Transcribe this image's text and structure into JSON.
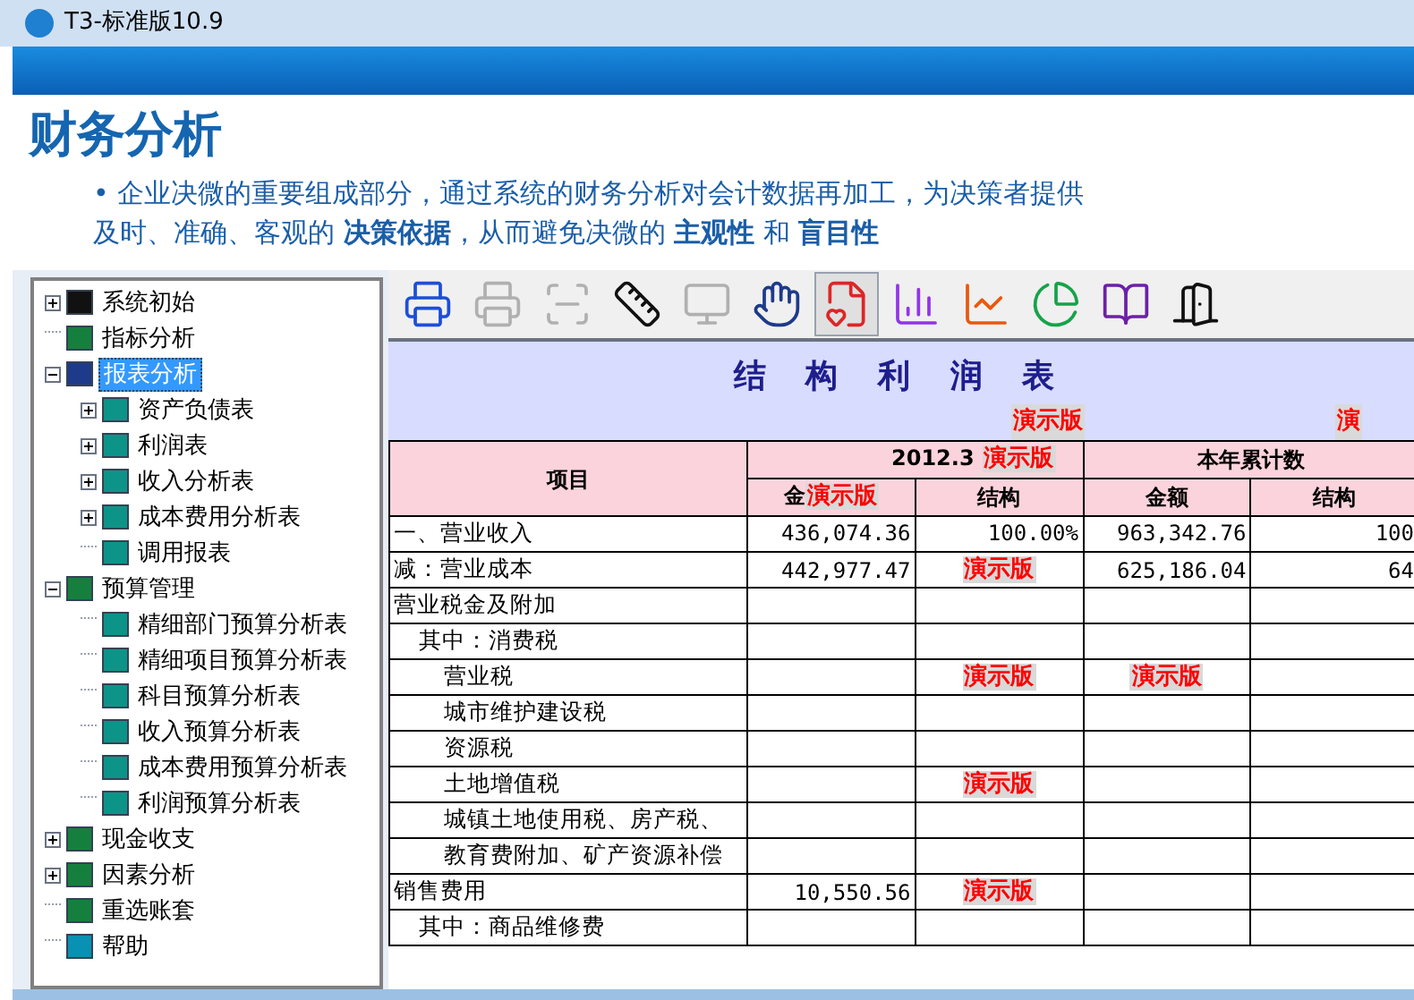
{
  "window": {
    "title": "T3-标准版10.9"
  },
  "heading": "财务分析",
  "description_lines": [
    "• 企业决微的重要组成部分，通过系统的财务分析对会计数据再加工，为决策者提供",
    "及时、准确、客观的 **决策依据**，从而避免决微的 **主观性** 和 **盲目性**"
  ],
  "tree": [
    {
      "label": "系统初始",
      "selected": false,
      "expanded": false
    },
    {
      "label": "指标分析",
      "selected": false
    },
    {
      "label": "报表分析",
      "selected": true,
      "expanded": true,
      "children": [
        {
          "label": "资产负债表",
          "selected": false,
          "expanded": false
        },
        {
          "label": "利润表",
          "selected": false,
          "expanded": false
        },
        {
          "label": "收入分析表",
          "selected": false,
          "expanded": false
        },
        {
          "label": "成本费用分析表",
          "selected": false,
          "expanded": false
        },
        {
          "label": "调用报表",
          "selected": false
        }
      ]
    },
    {
      "label": "预算管理",
      "selected": false,
      "expanded": true,
      "children": [
        {
          "label": "精细部门预算分析表",
          "selected": false
        },
        {
          "label": "精细项目预算分析表",
          "selected": false
        },
        {
          "label": "科目预算分析表",
          "selected": false
        },
        {
          "label": "收入预算分析表",
          "selected": false
        },
        {
          "label": "成本费用预算分析表",
          "selected": false
        },
        {
          "label": "利润预算分析表",
          "selected": false
        }
      ]
    },
    {
      "label": "现金收支",
      "selected": false,
      "expanded": false
    },
    {
      "label": "因素分析",
      "selected": false,
      "expanded": false
    },
    {
      "label": "重选账套",
      "selected": false
    },
    {
      "label": "帮助",
      "selected": false
    }
  ],
  "toolbar": [
    {
      "disabled": false,
      "selected": false
    },
    {
      "disabled": true,
      "selected": false
    },
    {
      "disabled": true,
      "selected": false
    },
    {
      "disabled": false,
      "selected": false
    },
    {
      "disabled": true,
      "selected": false
    },
    {
      "disabled": false,
      "selected": false
    },
    {
      "disabled": false,
      "selected": true
    },
    {
      "disabled": false,
      "selected": false
    },
    {
      "disabled": false,
      "selected": false
    },
    {
      "disabled": false,
      "selected": false
    },
    {
      "disabled": false,
      "selected": false
    },
    {
      "disabled": false,
      "selected": false
    }
  ],
  "report": {
    "title": "结 构 利 润 表",
    "title_stamps": [
      "演示版",
      "演"
    ],
    "header": {
      "item": "项目",
      "period": "2012.3",
      "period_stamp": "演示版",
      "ytd": "本年累计数",
      "columns": [
        {
          "text": "金",
          "stamp": "演示版"
        },
        {
          "text": "结构"
        },
        {
          "text": "金额"
        },
        {
          "text": "结构"
        }
      ]
    },
    "rows": [
      {
        "label": "一、营业收入",
        "cells": [
          {
            "text": "436,074.36"
          },
          {
            "text": "100.00%"
          },
          {
            "text": "963,342.76"
          },
          {
            "text": "100"
          }
        ]
      },
      {
        "label": "减：营业成本",
        "cells": [
          {
            "text": "442,977.47"
          },
          {
            "stamp": "演示版"
          },
          {
            "text": "625,186.04"
          },
          {
            "text": "64"
          }
        ]
      },
      {
        "label": "营业税金及附加",
        "cells": [
          {},
          {},
          {},
          {}
        ],
        "children": [
          {
            "label": "其中：消费税",
            "cells": [
              {},
              {},
              {},
              {}
            ],
            "children": [
              {
                "label": "营业税",
                "cells": [
                  {},
                  {
                    "stamp": "演示版"
                  },
                  {
                    "stamp": "演示版"
                  },
                  {}
                ]
              },
              {
                "label": "城市维护建设税",
                "cells": [
                  {},
                  {},
                  {},
                  {}
                ]
              },
              {
                "label": "资源税",
                "cells": [
                  {},
                  {},
                  {},
                  {}
                ]
              },
              {
                "label": "土地增值税",
                "cells": [
                  {},
                  {
                    "stamp": "演示版"
                  },
                  {},
                  {}
                ]
              },
              {
                "label": "城镇土地使用税、房产税、",
                "cells": [
                  {},
                  {},
                  {},
                  {}
                ]
              },
              {
                "label": "教育费附加、矿产资源补偿",
                "cells": [
                  {},
                  {},
                  {},
                  {}
                ]
              }
            ]
          }
        ]
      },
      {
        "label": "销售费用",
        "cells": [
          {
            "text": "10,550.56"
          },
          {
            "stamp": "演示版"
          },
          {},
          {}
        ],
        "children": [
          {
            "label": "其中：商品维修费",
            "cells": [
              {},
              {},
              {},
              {}
            ]
          }
        ]
      }
    ]
  }
}
